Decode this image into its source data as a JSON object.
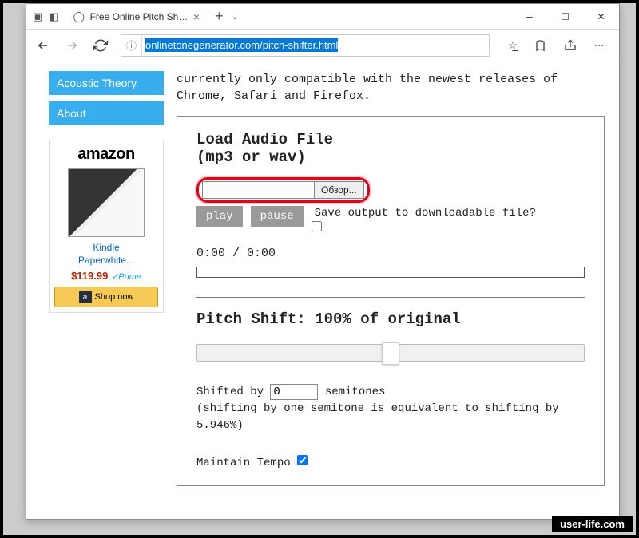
{
  "browser": {
    "tab_title": "Free Online Pitch Shifte",
    "url_display": "onlinetonegenerator.com/pitch-shifter.html"
  },
  "sidebar": {
    "items": [
      "Acoustic Theory",
      "About"
    ]
  },
  "ad": {
    "brand": "amazon",
    "product_line1": "Kindle",
    "product_line2": "Paperwhite...",
    "price": "$119.99",
    "prime": "Prime",
    "shop_label": "Shop now"
  },
  "main": {
    "intro": "currently only compatible with the newest releases of Chrome, Safari and Firefox.",
    "load_title_1": "Load Audio File",
    "load_title_2": "(mp3 or wav)",
    "browse_label": "Обзор...",
    "play_label": "play",
    "pause_label": "pause",
    "save_label": "Save output to downloadable file?",
    "time": "0:00 / 0:00",
    "pitch_title": "Pitch Shift: 100% of original",
    "slider_value_percent": 50,
    "semitone_prefix": "Shifted by",
    "semitone_value": "0",
    "semitone_suffix": "semitones",
    "semitone_note": "(shifting by one semitone is equivalent to shifting by 5.946%)",
    "maintain_label": "Maintain Tempo"
  },
  "watermark": "user-life.com"
}
